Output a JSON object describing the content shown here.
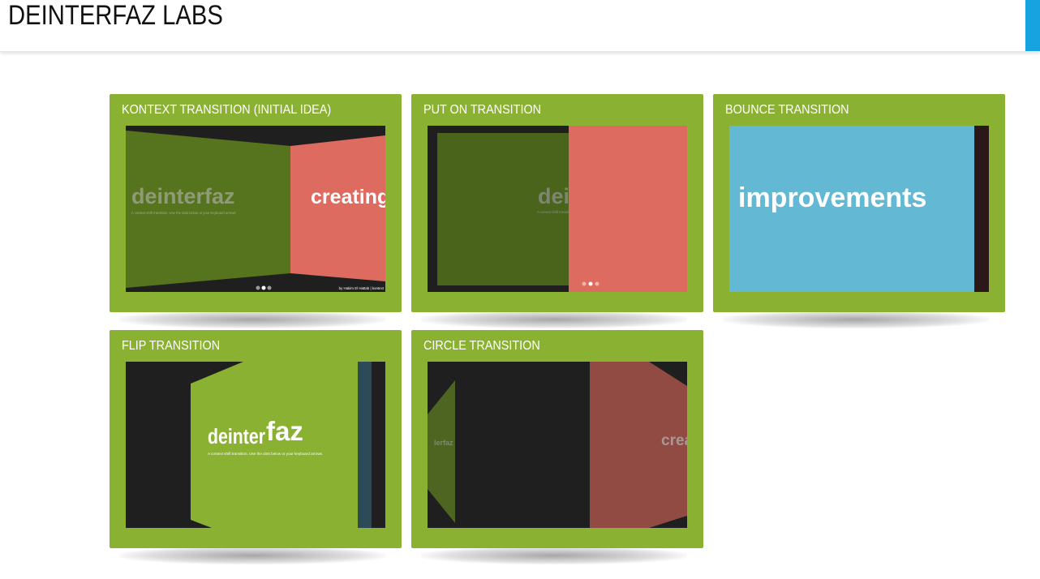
{
  "header": {
    "title": "DEINTERFAZ LABS"
  },
  "colors": {
    "card_bg": "#8ab131",
    "accent": "#17a3e0",
    "salmon": "#dd6b5f",
    "dark_green": "#4d6a1b",
    "sky": "#63b9d3",
    "dark": "#1f1f1f"
  },
  "cards": [
    {
      "title": "KONTEXT TRANSITION (INITIAL IDEA)",
      "preview": {
        "left_word": "deinterfaz",
        "left_sub": "A context shift transition. Use the dots below or your keyboard arrows",
        "right_word": "creating",
        "credit": "by Hakim El Hattab | kontext"
      }
    },
    {
      "title": "PUT ON TRANSITION",
      "preview": {
        "word": "dei",
        "sub": "A context shift transition"
      }
    },
    {
      "title": "BOUNCE TRANSITION",
      "preview": {
        "word": "improvements"
      }
    },
    {
      "title": "FLIP TRANSITION",
      "preview": {
        "word_a": "deinter",
        "word_b": "faz",
        "sub": "A context shift transition. Use the dots below or your keyboard arrows."
      }
    },
    {
      "title": "CIRCLE TRANSITION",
      "preview": {
        "word": "creati",
        "tiny": "lerfaz"
      }
    }
  ]
}
